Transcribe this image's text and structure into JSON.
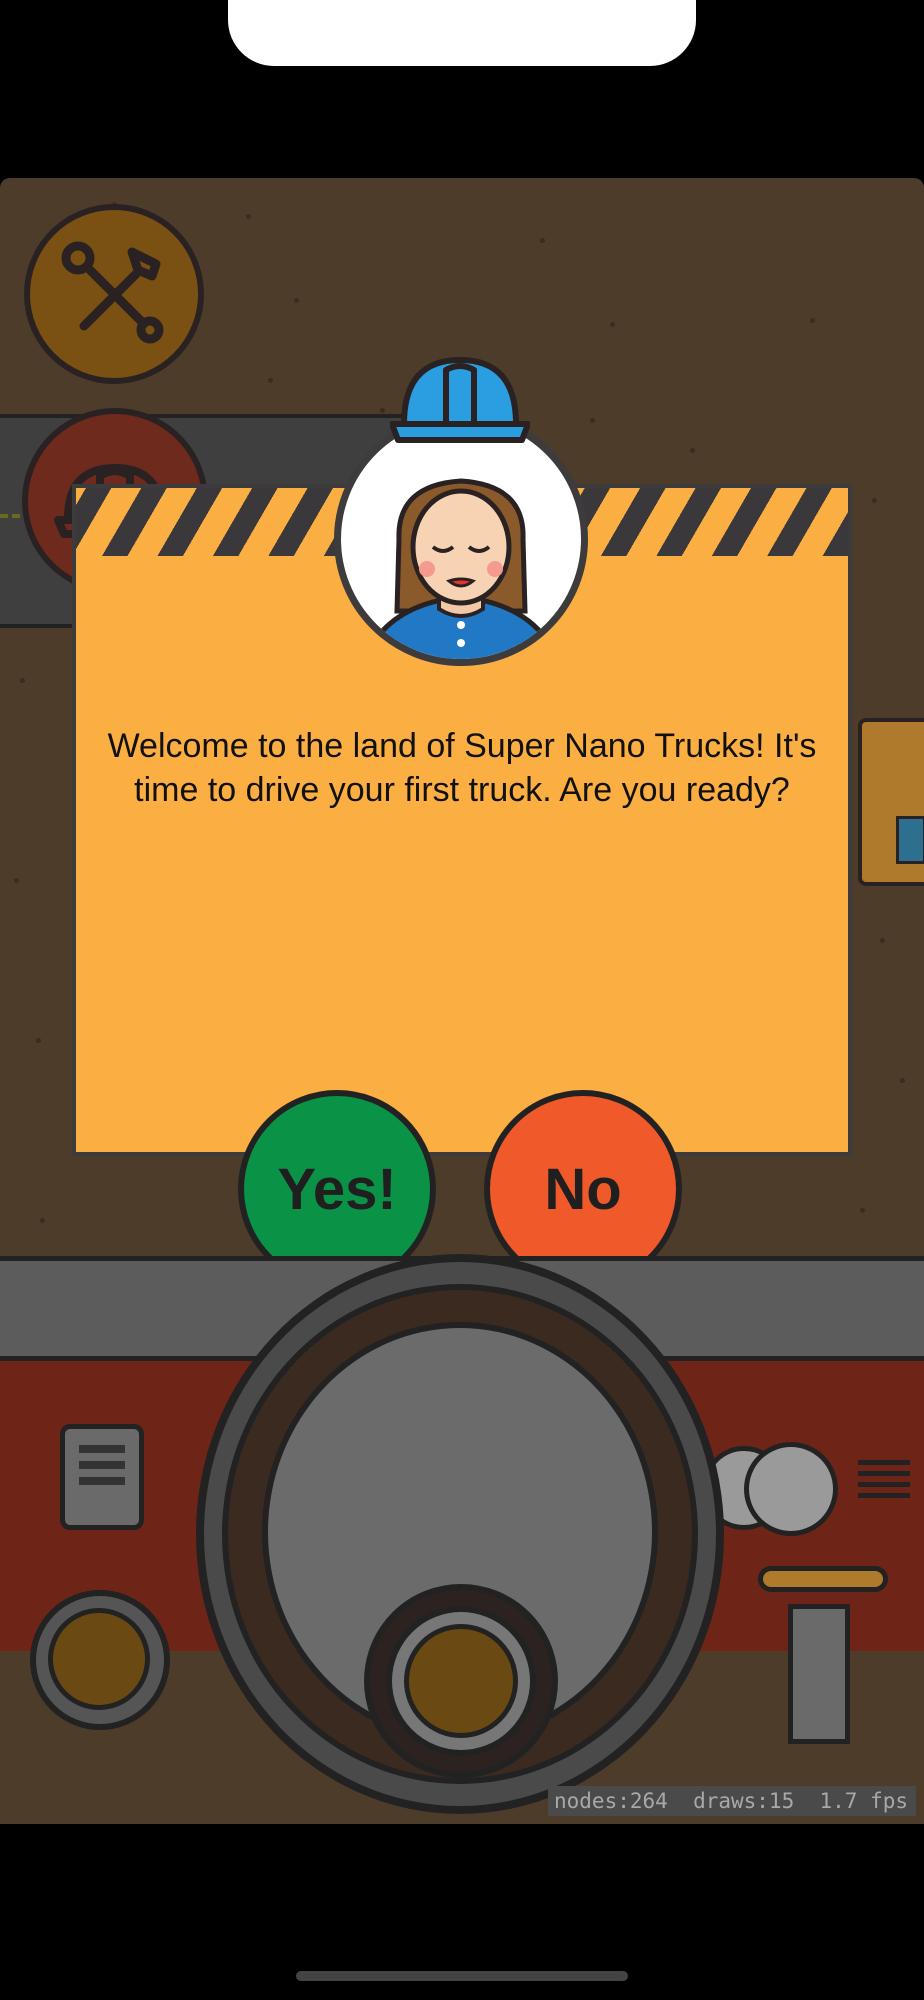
{
  "dialog": {
    "message": "Welcome to the land of Super Nano Trucks! It's time to drive your first truck. Are you ready?",
    "yes_label": "Yes!",
    "no_label": "No"
  },
  "hud": {
    "tools_icon": "tools-icon",
    "helmet_icon": "helmet-icon"
  },
  "debug": {
    "stats": "nodes:264  draws:15  1.7 fps"
  },
  "colors": {
    "background": "#4e3c2a",
    "modal": "#fbae42",
    "yes": "#0a9247",
    "no": "#f05a2b"
  }
}
